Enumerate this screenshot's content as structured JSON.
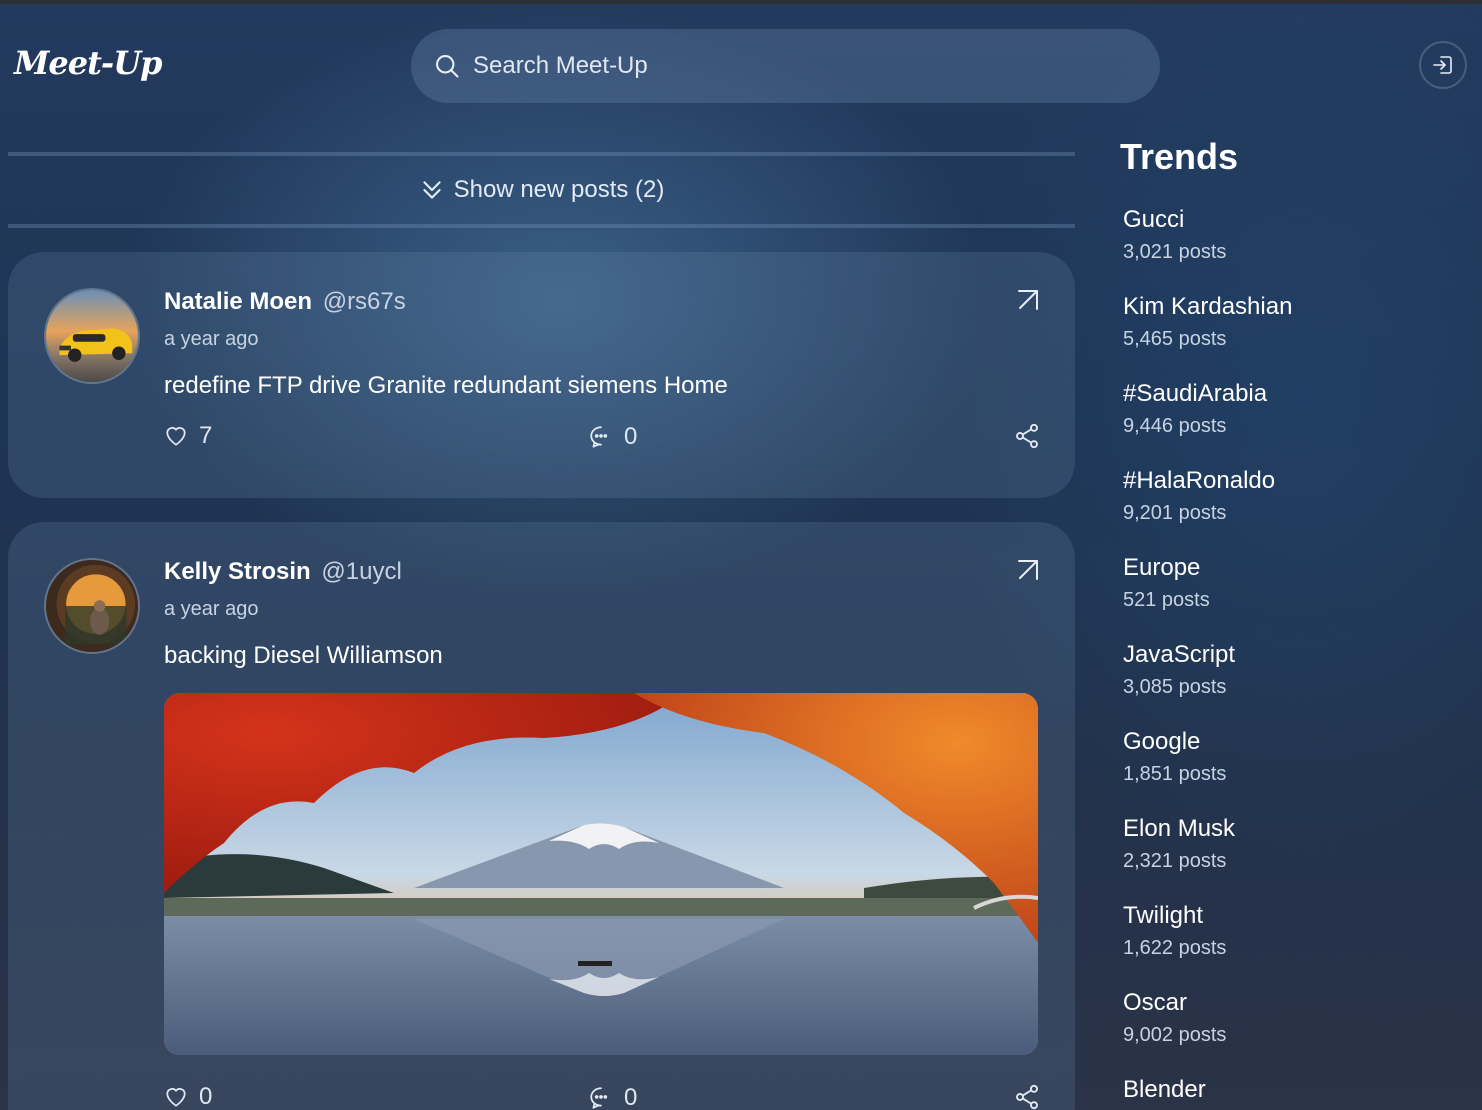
{
  "app": {
    "logo": "Meet-Up"
  },
  "search": {
    "placeholder": "Search Meet-Up"
  },
  "feed": {
    "new_posts_label": "Show new posts (2)",
    "posts": [
      {
        "name": "Natalie Moen",
        "handle": "@rs67s",
        "time": "a year ago",
        "text": "redefine FTP drive Granite redundant siemens Home",
        "likes": "7",
        "comments": "0"
      },
      {
        "name": "Kelly Strosin",
        "handle": "@1uycl",
        "time": "a year ago",
        "text": "backing Diesel Williamson",
        "likes": "0",
        "comments": "0"
      }
    ]
  },
  "trends": {
    "title": "Trends",
    "items": [
      {
        "name": "Gucci",
        "count": "3,021 posts"
      },
      {
        "name": "Kim Kardashian",
        "count": "5,465 posts"
      },
      {
        "name": "#SaudiArabia",
        "count": "9,446 posts"
      },
      {
        "name": "#HalaRonaldo",
        "count": "9,201 posts"
      },
      {
        "name": "Europe",
        "count": "521 posts"
      },
      {
        "name": "JavaScript",
        "count": "3,085 posts"
      },
      {
        "name": "Google",
        "count": "1,851 posts"
      },
      {
        "name": "Elon Musk",
        "count": "2,321 posts"
      },
      {
        "name": "Twilight",
        "count": "1,622 posts"
      },
      {
        "name": "Oscar",
        "count": "9,002 posts"
      },
      {
        "name": "Blender",
        "count": ""
      }
    ]
  }
}
